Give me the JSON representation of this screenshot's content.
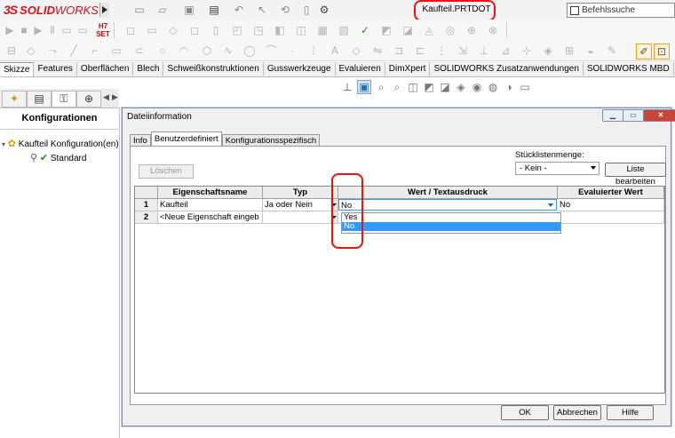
{
  "app": {
    "logo_ds": "3S",
    "logo_solid": "SOLID",
    "logo_works": "WORKS"
  },
  "document": {
    "title": "Kaufteil.PRTDOT"
  },
  "command_search": {
    "placeholder": "Befehlssuche"
  },
  "command_tabs": [
    "Skizze",
    "Features",
    "Oberflächen",
    "Blech",
    "Schweißkonstruktionen",
    "Gusswerkzeuge",
    "Evaluieren",
    "DimXpert",
    "SOLIDWORKS Zusatzanwendungen",
    "SOLIDWORKS MBD"
  ],
  "left_panel": {
    "title": "Konfigurationen",
    "tree": [
      {
        "label": "Kaufteil Konfiguration(en)"
      },
      {
        "label": "Standard"
      }
    ]
  },
  "dialog": {
    "title": "Dateiinformation",
    "tabs": [
      "Info",
      "Benutzerdefiniert",
      "Konfigurationsspezifisch"
    ],
    "active_tab": "Benutzerdefiniert",
    "delete_label": "Löschen",
    "bom_quantity_label": "Stücklistenmenge:",
    "bom_quantity_value": "- Kein -",
    "edit_list_label": "Liste bearbeiten",
    "columns": [
      "Eigenschaftsname",
      "Typ",
      "Wert / Textausdruck",
      "Evaluierter Wert"
    ],
    "rows": [
      {
        "num": "1",
        "name": "Kaufteil",
        "type": "Ja oder Nein",
        "value": "No",
        "evaluated": "No"
      },
      {
        "num": "2",
        "name": "<Neue Eigenschaft eingeb",
        "type": "",
        "value": "",
        "evaluated": ""
      }
    ],
    "dropdown_options": [
      "Yes",
      "No"
    ],
    "selected_option": "No",
    "ok_label": "OK",
    "cancel_label": "Abbrechen",
    "help_label": "Hilfe"
  },
  "colors": {
    "accent": "#3399ff",
    "brand": "#d6111e",
    "highlight": "#ee1111"
  }
}
